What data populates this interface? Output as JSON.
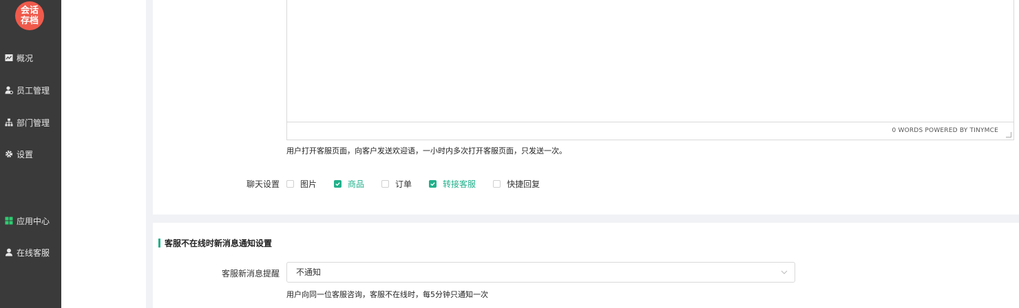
{
  "logo": {
    "line1": "会话",
    "line2": "存档"
  },
  "sidebar": {
    "items": [
      {
        "label": "概况",
        "icon": "chart-icon"
      },
      {
        "label": "员工管理",
        "icon": "user-gear-icon"
      },
      {
        "label": "部门管理",
        "icon": "org-chart-icon"
      },
      {
        "label": "设置",
        "icon": "gear-icon"
      },
      {
        "label": "应用中心",
        "icon": "grid-icon"
      },
      {
        "label": "在线客服",
        "icon": "support-agent-icon"
      }
    ]
  },
  "editor": {
    "status": "0 WORDS POWERED BY TINYMCE"
  },
  "welcome_hint": "用户打开客服页面，向客户发送欢迎语，一小时内多次打开客服页面，只发送一次。",
  "chat_settings": {
    "label": "聊天设置",
    "options": [
      {
        "label": "图片",
        "checked": false
      },
      {
        "label": "商品",
        "checked": true
      },
      {
        "label": "订单",
        "checked": false
      },
      {
        "label": "转接客服",
        "checked": true
      },
      {
        "label": "快捷回复",
        "checked": false
      }
    ]
  },
  "offline_section": {
    "title": "客服不在线时新消息通知设置",
    "field_label": "客服新消息提醒",
    "selected": "不通知",
    "hint": "用户向同一位客服咨询，客服不在线时，每5分钟只通知一次"
  },
  "colors": {
    "accent": "#20b08a",
    "sidebar_bg": "#3a3a3a",
    "logo_bg": "#ef5a4b"
  }
}
